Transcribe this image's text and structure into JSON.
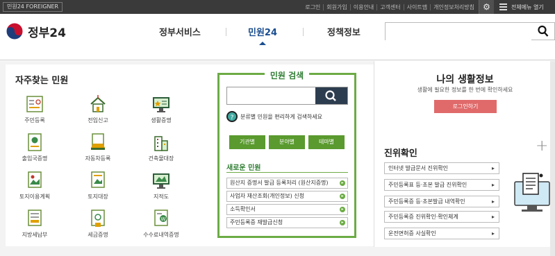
{
  "topbar": {
    "foreigner": "민원24 FOREIGNER",
    "links": [
      "로그인",
      "회원가입",
      "이용안내",
      "고객센터",
      "사이트맵",
      "개인정보처리방침"
    ],
    "allmenu": "전체메뉴 열기"
  },
  "header": {
    "logo_text": "정부24",
    "nav": [
      "정부서비스",
      "민원24",
      "정책정보"
    ],
    "search_placeholder": ""
  },
  "frequent": {
    "title": "자주찾는 민원",
    "items": [
      {
        "label": "주민등록",
        "icon": "id-card-icon"
      },
      {
        "label": "전입신고",
        "icon": "house-icon"
      },
      {
        "label": "생활증명",
        "icon": "monitor-certificate-icon"
      },
      {
        "label": "출입국증명",
        "icon": "passport-icon"
      },
      {
        "label": "자동차등록",
        "icon": "car-document-icon"
      },
      {
        "label": "건축물대장",
        "icon": "building-icon"
      },
      {
        "label": "토지이용계획",
        "icon": "land-map-icon"
      },
      {
        "label": "토지대장",
        "icon": "land-register-icon"
      },
      {
        "label": "지적도",
        "icon": "monitor-map-icon"
      },
      {
        "label": "지방세납부",
        "icon": "tax-document-icon"
      },
      {
        "label": "세금증명",
        "icon": "tax-certificate-icon"
      },
      {
        "label": "수수료내역증명",
        "icon": "fee-certificate-icon"
      }
    ]
  },
  "civil_search": {
    "title": "민원 검색",
    "hint": "분류별 민원을 편리하게 검색하세요",
    "buttons": [
      "기관별",
      "분야별",
      "테마별"
    ],
    "new_title": "새로운 민원",
    "new_items": [
      "원산지 증명서 발급 등록처리 (원산지증명)",
      "사업자 재산조회(개인정보) 신청",
      "소득확인서",
      "주민등록증 재발급신청"
    ]
  },
  "mylife": {
    "title": "나의 생활정보",
    "desc": "생활에 필요한 정보를 한 번에 확인하세요",
    "login": "로그인하기"
  },
  "verify": {
    "title": "진위확인",
    "items": [
      "인터넷 발급문서 진위확인",
      "주민등록표 등·초본 발급 진위확인",
      "주민등록증 등·초본발급 내역확인",
      "주민등록증 진위확인·확인체계",
      "운전면허증 사실확인"
    ]
  }
}
